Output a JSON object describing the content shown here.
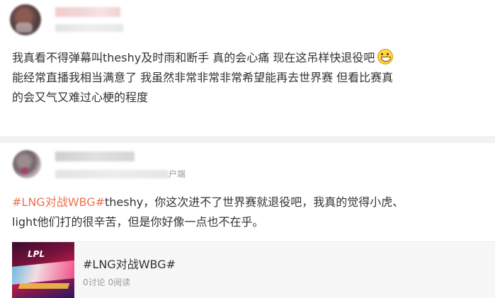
{
  "post1": {
    "text": "我真看不得弹幕叫theshy及时雨和断手 真的会心心痛 现在这吊样快退役吧",
    "text_line1": "我真看不得弹幕叫theshy及时雨和断手 真的会心痛 现在这吊样快退役吧",
    "text_line2": "能经常直播我相当满意了 我虽然非常非常非常希望能再去世界赛 但看比赛真",
    "text_line3": "的会又气又难过心梗的程度",
    "emoji_icon": "grinning-sweat-emoji"
  },
  "post2": {
    "source_suffix": "户端",
    "topic": "#LNG对战WBG#",
    "text_line1_rest": "theshy，你这次进不了世界赛就退役吧，我真的觉得小虎、",
    "text_line2": "light他们打的很辛苦，但是你好像一点也不在乎。"
  },
  "topic_card": {
    "thumb_label": "LPL",
    "title": "#LNG对战WBG#",
    "stats": "0讨论 0阅读"
  },
  "colors": {
    "topic": "#eb7350",
    "text": "#333333",
    "meta": "#999999",
    "divider": "#f2f2f2",
    "card_bg": "#f7f7f7"
  }
}
